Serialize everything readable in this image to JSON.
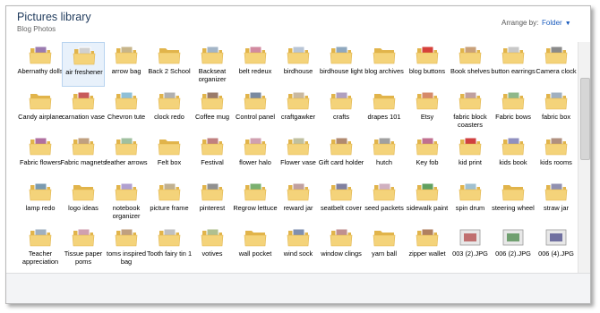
{
  "header": {
    "title": "Pictures library",
    "subtitle": "Blog Photos",
    "arrange_label": "Arrange by:",
    "arrange_value": "Folder"
  },
  "colors": {
    "folder": "#f4d37a",
    "folder_dark": "#e1b44b",
    "title": "#1e395b",
    "link": "#1a5bbd"
  },
  "items": [
    {
      "label": "Abernathy dolls",
      "kind": "folder",
      "icon": "folder-icon",
      "accent": "#9b7bb0"
    },
    {
      "label": "air freshener",
      "kind": "folder",
      "icon": "folder-icon",
      "accent": "#d0d0d0",
      "selected": true
    },
    {
      "label": "arrow bag",
      "kind": "folder",
      "icon": "folder-icon",
      "accent": "#c7b58a"
    },
    {
      "label": "Back 2 School",
      "kind": "folder",
      "icon": "folder-icon",
      "accent": ""
    },
    {
      "label": "Backseat organizer",
      "kind": "folder",
      "icon": "folder-icon",
      "accent": "#a3b5c7"
    },
    {
      "label": "belt redeux",
      "kind": "folder",
      "icon": "folder-icon",
      "accent": "#d28aa0"
    },
    {
      "label": "birdhouse",
      "kind": "folder",
      "icon": "folder-icon",
      "accent": "#b8c5d6"
    },
    {
      "label": "birdhouse light",
      "kind": "folder",
      "icon": "folder-icon",
      "accent": "#8fa8bf"
    },
    {
      "label": "blog archives",
      "kind": "folder",
      "icon": "folder-icon",
      "accent": ""
    },
    {
      "label": "blog buttons",
      "kind": "folder",
      "icon": "folder-icon",
      "accent": "#d6403a"
    },
    {
      "label": "Book shelves",
      "kind": "folder",
      "icon": "folder-icon",
      "accent": "#c9a17a"
    },
    {
      "label": "button earrings",
      "kind": "folder",
      "icon": "folder-icon",
      "accent": "#c8c8c8"
    },
    {
      "label": "Camera clock",
      "kind": "folder",
      "icon": "folder-icon",
      "accent": "#8a8a8a"
    },
    {
      "label": "Candy airplane",
      "kind": "folder",
      "icon": "folder-icon",
      "accent": ""
    },
    {
      "label": "carnation vase",
      "kind": "folder",
      "icon": "folder-icon",
      "accent": "#c85a5a"
    },
    {
      "label": "Chevron tute",
      "kind": "folder",
      "icon": "folder-icon",
      "accent": "#8fc0d8"
    },
    {
      "label": "clock redo",
      "kind": "folder",
      "icon": "folder-icon",
      "accent": "#b0b0b0"
    },
    {
      "label": "Coffee mug",
      "kind": "folder",
      "icon": "folder-icon",
      "accent": "#9a7b6a"
    },
    {
      "label": "Control panel",
      "kind": "folder",
      "icon": "folder-icon",
      "accent": "#7a8aa0"
    },
    {
      "label": "craftgawker",
      "kind": "folder",
      "icon": "folder-icon",
      "accent": "#c9b9a0"
    },
    {
      "label": "crafts",
      "kind": "folder",
      "icon": "folder-icon",
      "accent": "#b0a0c0"
    },
    {
      "label": "drapes 101",
      "kind": "folder",
      "icon": "folder-icon",
      "accent": ""
    },
    {
      "label": "Etsy",
      "kind": "folder",
      "icon": "folder-icon",
      "accent": "#d68a6a"
    },
    {
      "label": "fabric block coasters",
      "kind": "folder",
      "icon": "folder-icon",
      "accent": "#c0a0a0"
    },
    {
      "label": "Fabric bows",
      "kind": "folder",
      "icon": "folder-icon",
      "accent": "#8fb88a"
    },
    {
      "label": "fabric box",
      "kind": "folder",
      "icon": "folder-icon",
      "accent": "#a0b0c0"
    },
    {
      "label": "Fabric flowers",
      "kind": "folder",
      "icon": "folder-icon",
      "accent": "#b070a0"
    },
    {
      "label": "Fabric magnets",
      "kind": "folder",
      "icon": "folder-icon",
      "accent": "#c0a080"
    },
    {
      "label": "feather arrows",
      "kind": "folder",
      "icon": "folder-icon",
      "accent": "#a0c0a0"
    },
    {
      "label": "Felt box",
      "kind": "folder",
      "icon": "folder-icon",
      "accent": ""
    },
    {
      "label": "Festival",
      "kind": "folder",
      "icon": "folder-icon",
      "accent": "#c08080"
    },
    {
      "label": "flower halo",
      "kind": "folder",
      "icon": "folder-icon",
      "accent": "#d0a0b0"
    },
    {
      "label": "Flower vase",
      "kind": "folder",
      "icon": "folder-icon",
      "accent": "#c0c0a0"
    },
    {
      "label": "Gift card holder",
      "kind": "folder",
      "icon": "folder-icon",
      "accent": "#b08a70"
    },
    {
      "label": "hutch",
      "kind": "folder",
      "icon": "folder-icon",
      "accent": "#a0a0a0"
    },
    {
      "label": "Key fob",
      "kind": "folder",
      "icon": "folder-icon",
      "accent": "#c07090"
    },
    {
      "label": "kid print",
      "kind": "folder",
      "icon": "folder-icon",
      "accent": "#d04040"
    },
    {
      "label": "kids book",
      "kind": "folder",
      "icon": "folder-icon",
      "accent": "#9090c0"
    },
    {
      "label": "kids rooms",
      "kind": "folder",
      "icon": "folder-icon",
      "accent": "#b09080"
    },
    {
      "label": "lamp redo",
      "kind": "folder",
      "icon": "folder-icon",
      "accent": "#7a9ab0"
    },
    {
      "label": "logo ideas",
      "kind": "folder",
      "icon": "folder-icon",
      "accent": ""
    },
    {
      "label": "notebook organizer",
      "kind": "folder",
      "icon": "folder-icon",
      "accent": "#b0a0d0"
    },
    {
      "label": "picture frame",
      "kind": "folder",
      "icon": "folder-icon",
      "accent": "#c0b090"
    },
    {
      "label": "pinterest",
      "kind": "folder",
      "icon": "folder-icon",
      "accent": "#909090"
    },
    {
      "label": "Regrow lettuce",
      "kind": "folder",
      "icon": "folder-icon",
      "accent": "#7ab070"
    },
    {
      "label": "reward jar",
      "kind": "folder",
      "icon": "folder-icon",
      "accent": "#c0a0a0"
    },
    {
      "label": "seatbelt cover",
      "kind": "folder",
      "icon": "folder-icon",
      "accent": "#8080a0"
    },
    {
      "label": "seed packets",
      "kind": "folder",
      "icon": "folder-icon",
      "accent": "#d0b0c0"
    },
    {
      "label": "sidewalk paint",
      "kind": "folder",
      "icon": "folder-icon",
      "accent": "#60a060"
    },
    {
      "label": "spin drum",
      "kind": "folder",
      "icon": "folder-icon",
      "accent": "#a0c0d0"
    },
    {
      "label": "steering wheel",
      "kind": "folder",
      "icon": "folder-icon",
      "accent": ""
    },
    {
      "label": "straw jar",
      "kind": "folder",
      "icon": "folder-icon",
      "accent": "#9090b0"
    },
    {
      "label": "Teacher appreciation",
      "kind": "folder",
      "icon": "folder-icon",
      "accent": "#a0b0c0"
    },
    {
      "label": "Tissue paper poms",
      "kind": "folder",
      "icon": "folder-icon",
      "accent": "#d0a0b0"
    },
    {
      "label": "toms inspired bag",
      "kind": "folder",
      "icon": "folder-icon",
      "accent": "#c0a080"
    },
    {
      "label": "Tooth fairy tin 1",
      "kind": "folder",
      "icon": "folder-icon",
      "accent": "#c0c0c0"
    },
    {
      "label": "votives",
      "kind": "folder",
      "icon": "folder-icon",
      "accent": "#b0c090"
    },
    {
      "label": "wall pocket",
      "kind": "folder",
      "icon": "folder-icon",
      "accent": ""
    },
    {
      "label": "wind sock",
      "kind": "folder",
      "icon": "folder-icon",
      "accent": "#8090b0"
    },
    {
      "label": "window clings",
      "kind": "folder",
      "icon": "folder-icon",
      "accent": "#c09090"
    },
    {
      "label": "yarn ball",
      "kind": "folder",
      "icon": "folder-icon",
      "accent": ""
    },
    {
      "label": "zipper wallet",
      "kind": "folder",
      "icon": "folder-icon",
      "accent": "#b08060"
    },
    {
      "label": "003 (2).JPG",
      "kind": "image",
      "icon": "photo-thumbnail-icon",
      "accent": "#c07070"
    },
    {
      "label": "006 (2).JPG",
      "kind": "image",
      "icon": "photo-thumbnail-icon",
      "accent": "#70a070"
    },
    {
      "label": "006 (4).JPG",
      "kind": "image",
      "icon": "photo-thumbnail-icon",
      "accent": "#7070a0"
    }
  ]
}
